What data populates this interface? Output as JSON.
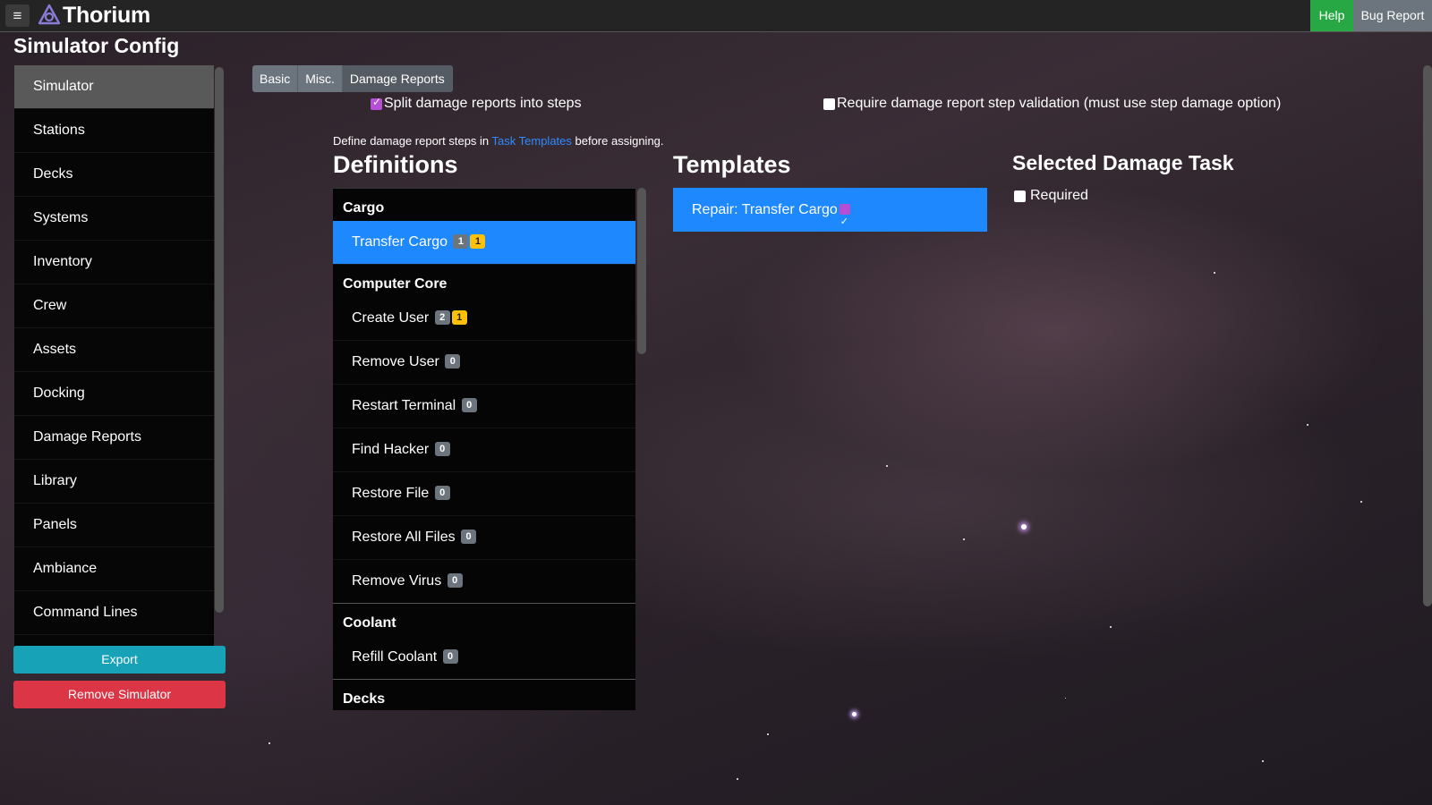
{
  "app": {
    "brand": "Thorium",
    "page_title": "Simulator Config",
    "menu_icon": "hamburger-icon",
    "logo_icon": "thorium-logo-icon",
    "help_label": "Help",
    "bug_report_label": "Bug Report"
  },
  "sidebar": {
    "items": [
      {
        "label": "Simulator"
      },
      {
        "label": "Stations"
      },
      {
        "label": "Decks"
      },
      {
        "label": "Systems"
      },
      {
        "label": "Inventory"
      },
      {
        "label": "Crew"
      },
      {
        "label": "Assets"
      },
      {
        "label": "Docking"
      },
      {
        "label": "Damage Reports"
      },
      {
        "label": "Library"
      },
      {
        "label": "Panels"
      },
      {
        "label": "Ambiance"
      },
      {
        "label": "Command Lines"
      }
    ],
    "export_label": "Export",
    "remove_label": "Remove Simulator"
  },
  "tabs": [
    {
      "label": "Basic"
    },
    {
      "label": "Misc."
    },
    {
      "label": "Damage Reports"
    }
  ],
  "options": {
    "split_label": "Split damage reports into steps",
    "split_checked": true,
    "require_label": "Require damage report step validation (must use step damage option)",
    "require_checked": false
  },
  "info": {
    "prefix": "Define damage report steps in ",
    "link": "Task Templates",
    "suffix": " before assigning."
  },
  "definitions": {
    "title": "Definitions",
    "groups": [
      {
        "name": "Cargo",
        "items": [
          {
            "label": "Transfer Cargo",
            "count": "1",
            "flag": "1"
          }
        ]
      },
      {
        "name": "Computer Core",
        "items": [
          {
            "label": "Create User",
            "count": "2",
            "flag": "1"
          },
          {
            "label": "Remove User",
            "count": "0"
          },
          {
            "label": "Restart Terminal",
            "count": "0"
          },
          {
            "label": "Find Hacker",
            "count": "0"
          },
          {
            "label": "Restore File",
            "count": "0"
          },
          {
            "label": "Restore All Files",
            "count": "0"
          },
          {
            "label": "Remove Virus",
            "count": "0"
          }
        ]
      },
      {
        "name": "Coolant",
        "items": [
          {
            "label": "Refill Coolant",
            "count": "0"
          }
        ]
      },
      {
        "name": "Decks",
        "items": []
      }
    ]
  },
  "templates": {
    "title": "Templates",
    "items": [
      {
        "label": "Repair: Transfer Cargo",
        "icon": "checkmark-icon"
      }
    ]
  },
  "selected": {
    "title": "Selected Damage Task",
    "required_label": "Required",
    "required_checked": false
  },
  "colors": {
    "primary": "#1e88ff",
    "help": "#28a745",
    "secondary": "#6c757d",
    "export": "#17a2b8",
    "danger": "#dc3545",
    "badge_warning": "#ffc107",
    "checkbox": "#b44fd6"
  }
}
